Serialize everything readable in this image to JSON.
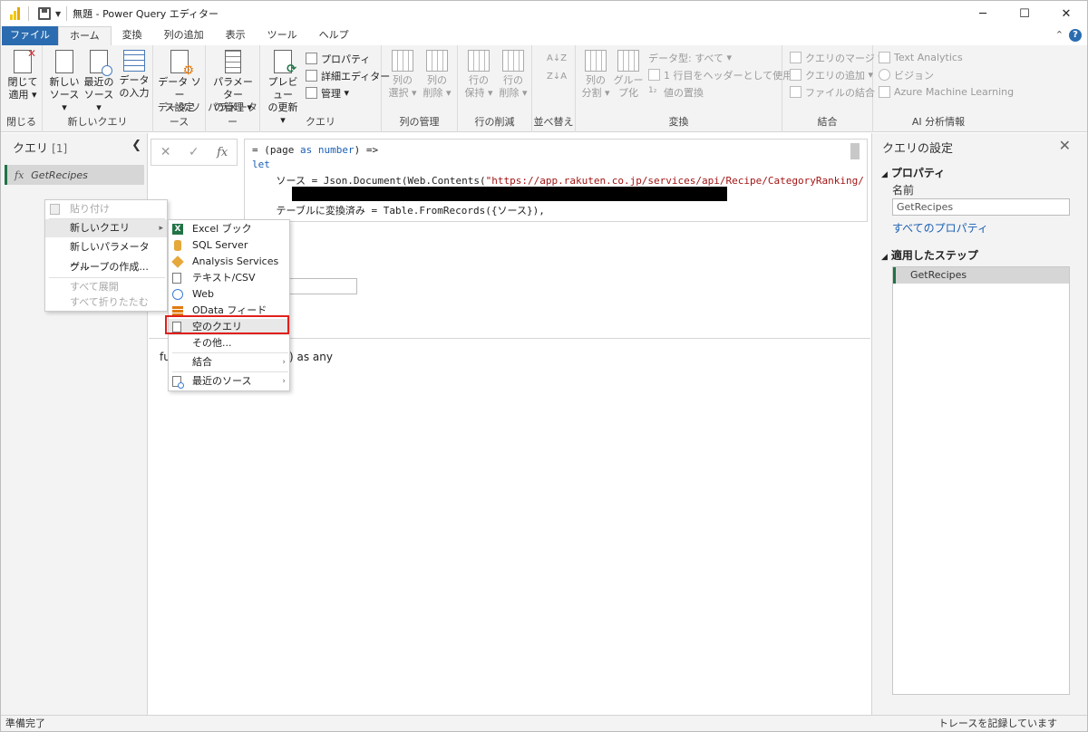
{
  "window": {
    "title": "無題 - Power Query エディター",
    "controls": {
      "minimize": "─",
      "maximize": "☐",
      "close": "✕"
    }
  },
  "ribbon_tabs": [
    "ファイル",
    "ホーム",
    "変換",
    "列の追加",
    "表示",
    "ツール",
    "ヘルプ"
  ],
  "ribbon": {
    "close_apply": {
      "line1": "閉じて",
      "line2": "適用",
      "group": "閉じる"
    },
    "new_query": {
      "group": "新しいクエリ",
      "new_source": [
        "新しい",
        "ソース"
      ],
      "recent_source": [
        "最近の",
        "ソース"
      ],
      "enter_data": [
        "データ",
        "の入力"
      ]
    },
    "data_source": {
      "group": "データ ソース",
      "btn": [
        "データ ソー",
        "ス設定"
      ]
    },
    "parameters": {
      "group": "パラメーター",
      "btn": [
        "パラメーター",
        "の管理"
      ]
    },
    "query": {
      "group": "クエリ",
      "refresh": [
        "プレビュー",
        "の更新"
      ],
      "properties": "プロパティ",
      "advanced_editor": "詳細エディター",
      "manage": "管理"
    },
    "columns": {
      "group": "列の管理",
      "select": [
        "列の",
        "選択"
      ],
      "remove": [
        "列の",
        "削除"
      ]
    },
    "rows": {
      "group": "行の削減",
      "keep": [
        "行の",
        "保持"
      ],
      "remove": [
        "行の",
        "削除"
      ]
    },
    "sort": {
      "group": "並べ替え"
    },
    "transform": {
      "group": "変換",
      "split": [
        "列の",
        "分割"
      ],
      "group_by": [
        "グルー",
        "プ化"
      ],
      "data_type": "データ型: すべて",
      "first_row": "1 行目をヘッダーとして使用",
      "replace": "値の置換"
    },
    "combine": {
      "group": "結合",
      "merge": "クエリのマージ",
      "append": "クエリの追加",
      "combine_files": "ファイルの結合"
    },
    "ai": {
      "group": "AI 分析情報",
      "text": "Text Analytics",
      "vision": "ビジョン",
      "azure": "Azure Machine Learning"
    }
  },
  "queries_panel": {
    "title": "クエリ",
    "count": "[1]",
    "items": [
      {
        "name": "GetRecipes",
        "fx": "fx"
      }
    ]
  },
  "formula_bar": {
    "fx": "fx",
    "cancel": "✕",
    "confirm": "✓"
  },
  "editor": {
    "line1_a": "= (page ",
    "line1_kw": "as",
    "line1_b": " ",
    "line1_kw2": "number",
    "line1_c": ") =>",
    "line2": "let",
    "line3_a": "    ソース = Json.Document(Web.Contents(",
    "line3_str": "\"https://app.rakuten.co.jp/services/api/Recipe/CategoryRanking/",
    "line5": "    テーブルに変換済み = Table.FromRecords({ソース}),"
  },
  "function_text_a": "fu",
  "function_text_b": ") as any",
  "context_menu": {
    "items": [
      {
        "label": "貼り付け",
        "disabled": true
      },
      {
        "label": "新しいクエリ",
        "disabled": false,
        "submenu": true
      },
      {
        "label": "新しいパラメーター...",
        "disabled": false
      },
      {
        "label": "グループの作成...",
        "disabled": false
      },
      {
        "label": "すべて展開",
        "disabled": true
      },
      {
        "label": "すべて折りたたむ",
        "disabled": true
      }
    ]
  },
  "submenu": {
    "items": [
      {
        "label": "Excel ブック",
        "icon": "excel-icon"
      },
      {
        "label": "SQL Server",
        "icon": "database-icon"
      },
      {
        "label": "Analysis Services",
        "icon": "cube-icon"
      },
      {
        "label": "テキスト/CSV",
        "icon": "text-file-icon"
      },
      {
        "label": "Web",
        "icon": "globe-icon"
      },
      {
        "label": "OData フィード",
        "icon": "odata-icon"
      },
      {
        "label": "空のクエリ",
        "icon": "blank-query-icon"
      },
      {
        "label": "その他...",
        "icon": ""
      },
      {
        "label": "結合",
        "icon": ""
      },
      {
        "label": "最近のソース",
        "icon": "recent-icon"
      }
    ]
  },
  "settings_panel": {
    "title": "クエリの設定",
    "properties_header": "プロパティ",
    "name_label": "名前",
    "name_value": "GetRecipes",
    "all_properties": "すべてのプロパティ",
    "steps_header": "適用したステップ",
    "steps": [
      "GetRecipes"
    ]
  },
  "status": {
    "left": "準備完了",
    "right": "トレースを記録しています"
  },
  "colors": {
    "file_tab": "#2b6cb0",
    "accent_green": "#217346",
    "highlight_red": "#e0201c"
  }
}
